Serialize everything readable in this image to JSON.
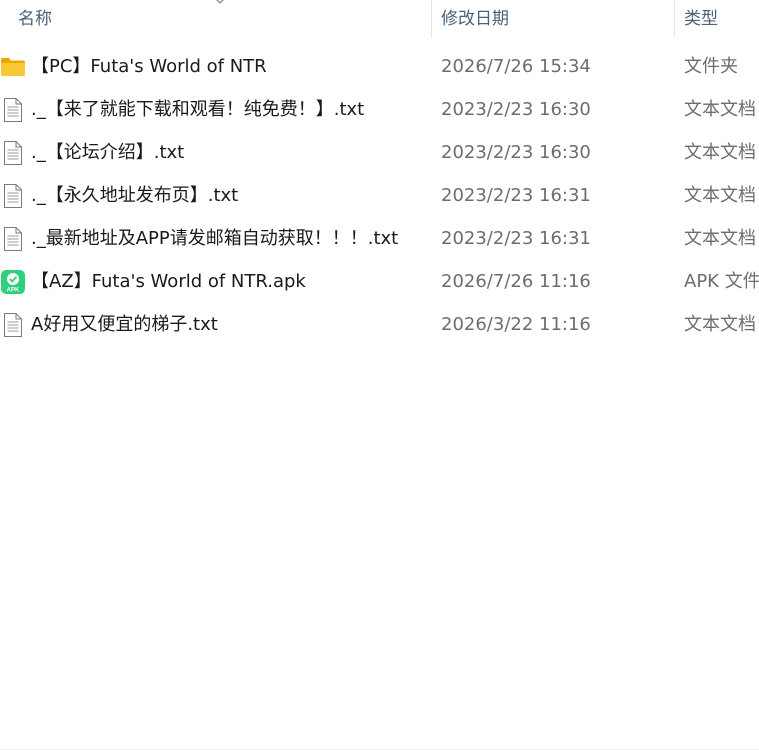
{
  "columns": {
    "name": "名称",
    "date_modified": "修改日期",
    "type": "类型"
  },
  "files": [
    {
      "name": "【PC】Futa's World of NTR",
      "date": "2026/7/26 15:34",
      "type": "文件夹",
      "icon": "folder-icon"
    },
    {
      "name": "._【来了就能下载和观看！纯免费！】.txt",
      "date": "2023/2/23 16:30",
      "type": "文本文档",
      "icon": "text-file-icon"
    },
    {
      "name": "._【论坛介绍】.txt",
      "date": "2023/2/23 16:30",
      "type": "文本文档",
      "icon": "text-file-icon"
    },
    {
      "name": "._【永久地址发布页】.txt",
      "date": "2023/2/23 16:31",
      "type": "文本文档",
      "icon": "text-file-icon"
    },
    {
      "name": "._最新地址及APP请发邮箱自动获取！！！.txt",
      "date": "2023/2/23 16:31",
      "type": "文本文档",
      "icon": "text-file-icon"
    },
    {
      "name": "【AZ】Futa's World of NTR.apk",
      "date": "2026/7/26 11:16",
      "type": "APK 文件",
      "icon": "apk-file-icon"
    },
    {
      "name": "A好用又便宜的梯子.txt",
      "date": "2026/3/22 11:16",
      "type": "文本文档",
      "icon": "text-file-icon"
    }
  ],
  "icons": {
    "apk_label": "APK"
  },
  "colors": {
    "header_text": "#4c607a",
    "folder": "#f5c518",
    "apk": "#2ecc71"
  }
}
